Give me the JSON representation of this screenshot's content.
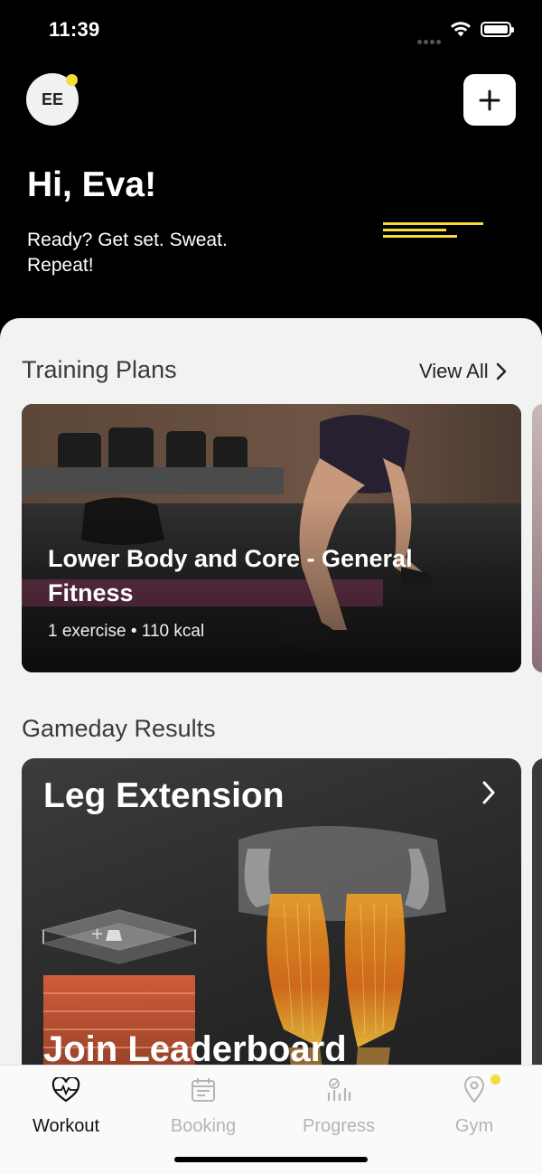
{
  "status_bar": {
    "time": "11:39"
  },
  "header": {
    "avatar_initials": "EE",
    "greeting": "Hi, Eva!",
    "subtitle": "Ready? Get set. Sweat. Repeat!",
    "accent_color": "#f4dc3a"
  },
  "training_plans": {
    "section_title": "Training Plans",
    "view_all_label": "View All",
    "card": {
      "title": "Lower Body and Core - General Fitness",
      "meta": "1 exercise • 110 kcal"
    }
  },
  "gameday": {
    "section_title": "Gameday Results",
    "card": {
      "title": "Leg Extension",
      "cta": "Join Leaderboard"
    }
  },
  "tab_bar": {
    "tabs": [
      {
        "label": "Workout",
        "icon": "heart-icon",
        "active": true
      },
      {
        "label": "Booking",
        "icon": "calendar-icon",
        "active": false
      },
      {
        "label": "Progress",
        "icon": "progress-chart-icon",
        "active": false
      },
      {
        "label": "Gym",
        "icon": "location-pin-icon",
        "active": false
      }
    ]
  }
}
